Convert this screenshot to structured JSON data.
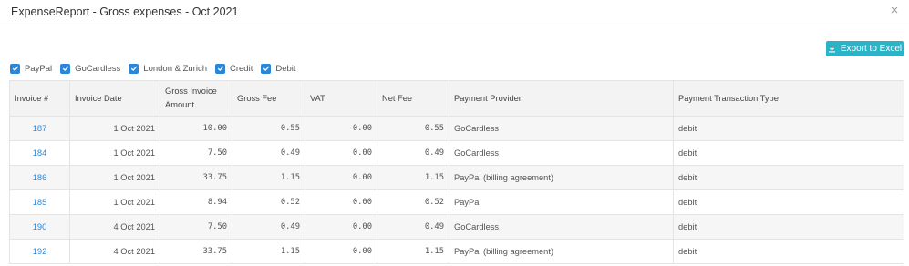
{
  "dialog": {
    "title": "ExpenseReport - Gross expenses - Oct 2021",
    "close_label": "×"
  },
  "toolbar": {
    "export_label": "Export to Excel",
    "export_icon": "download-icon",
    "accent_color": "#2bb3c8"
  },
  "filters": [
    {
      "label": "PayPal",
      "checked": true
    },
    {
      "label": "GoCardless",
      "checked": true
    },
    {
      "label": "London & Zurich",
      "checked": true
    },
    {
      "label": "Credit",
      "checked": true
    },
    {
      "label": "Debit",
      "checked": true
    }
  ],
  "table": {
    "headers": [
      "Invoice #",
      "Invoice Date",
      "Gross Invoice Amount",
      "Gross Fee",
      "VAT",
      "Net Fee",
      "Payment Provider",
      "Payment Transaction Type"
    ],
    "rows": [
      [
        "187",
        "1 Oct 2021",
        "10.00",
        "0.55",
        "0.00",
        "0.55",
        "GoCardless",
        "debit"
      ],
      [
        "184",
        "1 Oct 2021",
        "7.50",
        "0.49",
        "0.00",
        "0.49",
        "GoCardless",
        "debit"
      ],
      [
        "186",
        "1 Oct 2021",
        "33.75",
        "1.15",
        "0.00",
        "1.15",
        "PayPal (billing agreement)",
        "debit"
      ],
      [
        "185",
        "1 Oct 2021",
        "8.94",
        "0.52",
        "0.00",
        "0.52",
        "PayPal",
        "debit"
      ],
      [
        "190",
        "4 Oct 2021",
        "7.50",
        "0.49",
        "0.00",
        "0.49",
        "GoCardless",
        "debit"
      ],
      [
        "192",
        "4 Oct 2021",
        "33.75",
        "1.15",
        "0.00",
        "1.15",
        "PayPal (billing agreement)",
        "debit"
      ]
    ]
  },
  "colors": {
    "checkbox": "#2a86d8",
    "link": "#2a86d8",
    "header_bg": "#f3f3f3"
  }
}
